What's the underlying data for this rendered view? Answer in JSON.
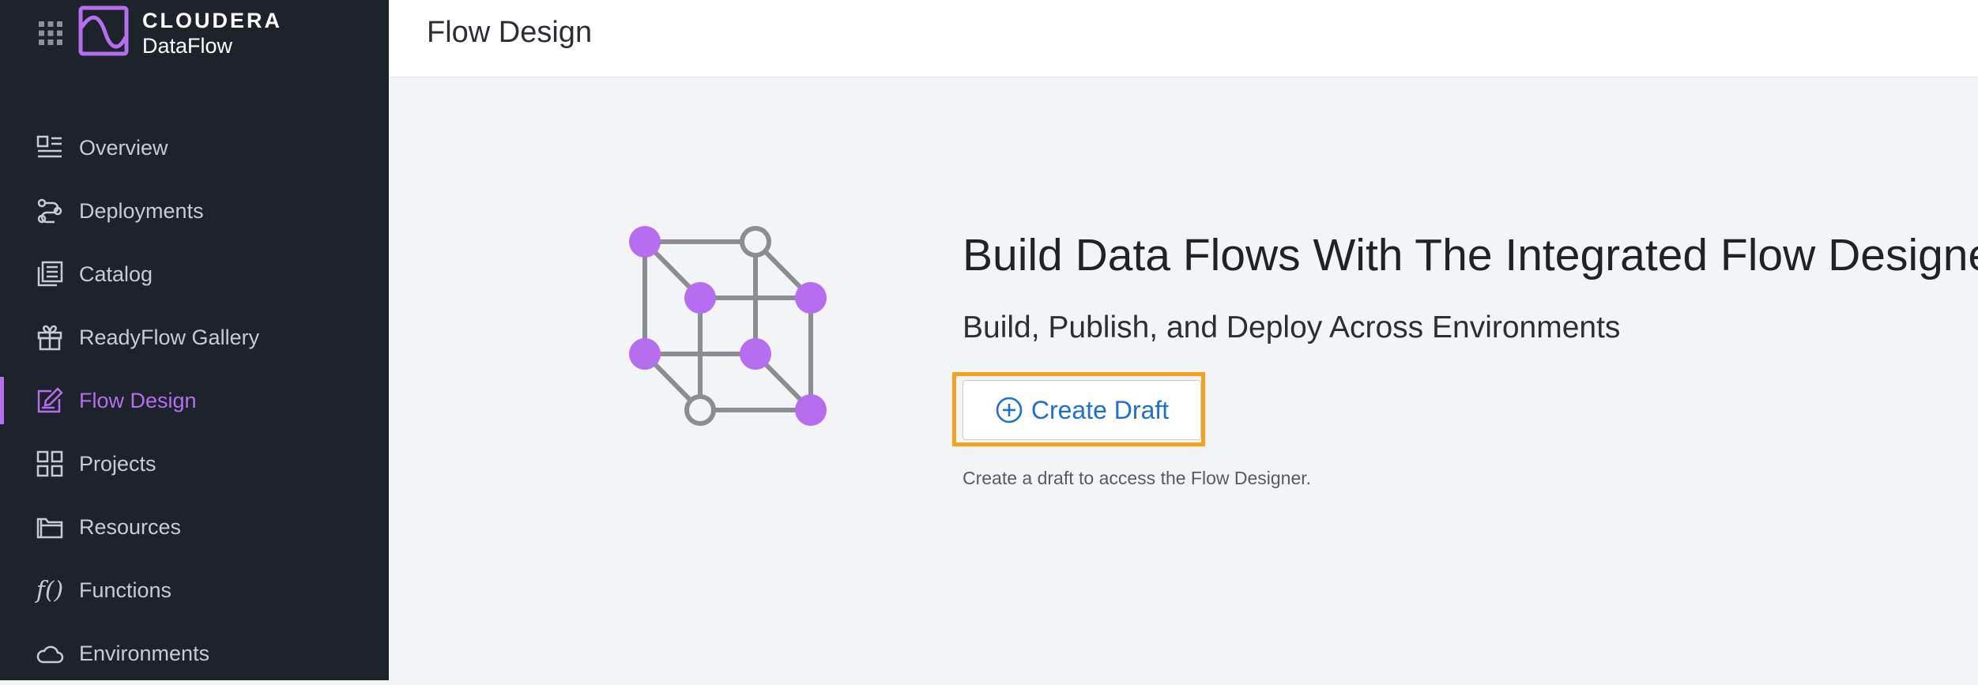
{
  "brand": {
    "top": "CLOUDERA",
    "bottom": "DataFlow"
  },
  "sidebar": {
    "items": [
      {
        "label": "Overview",
        "icon": "overview-icon",
        "active": false
      },
      {
        "label": "Deployments",
        "icon": "deployments-icon",
        "active": false
      },
      {
        "label": "Catalog",
        "icon": "catalog-icon",
        "active": false
      },
      {
        "label": "ReadyFlow Gallery",
        "icon": "gift-icon",
        "active": false
      },
      {
        "label": "Flow Design",
        "icon": "edit-icon",
        "active": true
      },
      {
        "label": "Projects",
        "icon": "projects-icon",
        "active": false
      },
      {
        "label": "Resources",
        "icon": "folder-icon",
        "active": false
      },
      {
        "label": "Functions",
        "icon": "function-icon",
        "active": false
      },
      {
        "label": "Environments",
        "icon": "cloud-icon",
        "active": false
      }
    ]
  },
  "header": {
    "title": "Flow Design"
  },
  "main": {
    "title": "Build Data Flows With The Integrated Flow Designer",
    "subtitle": "Build, Publish, and Deploy Across Environments",
    "create_button": "Create Draft",
    "hint": "Create a draft to access the Flow Designer."
  },
  "colors": {
    "sidebar_bg": "#1c232b",
    "accent": "#b66df0",
    "link_blue": "#1f6fd1",
    "highlight": "#f5a11b",
    "main_bg": "#f3f4f6"
  }
}
